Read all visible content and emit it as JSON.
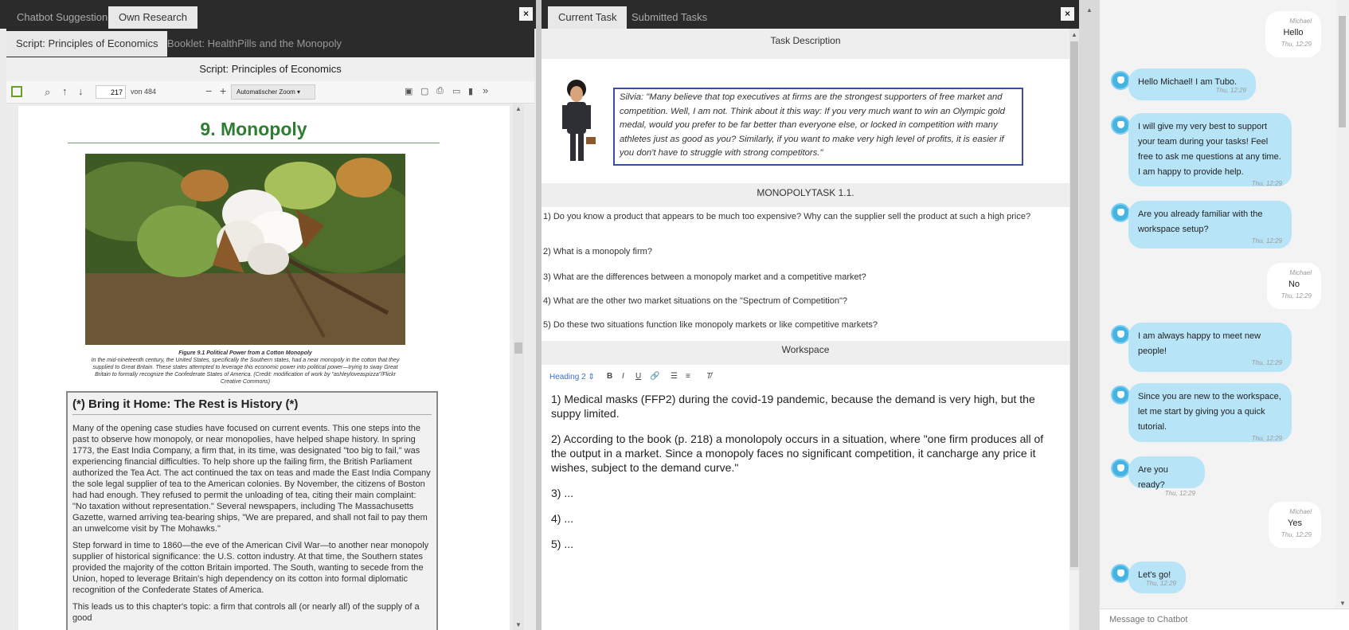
{
  "left": {
    "tabs": [
      {
        "label": "Chatbot Suggestion",
        "active": false
      },
      {
        "label": "Own Research",
        "active": true
      }
    ],
    "subtabs": [
      {
        "label": "Script: Principles of Economics",
        "active": true
      },
      {
        "label": "Booklet: HealthPills and the Monopoly",
        "active": false
      }
    ],
    "doc_title": "Script: Principles of Economics",
    "pdf_toolbar": {
      "page": "217",
      "page_total": "von 484",
      "zoom": "Automatischer Zoom"
    },
    "chapter_title": "9.   Monopoly",
    "figure_caption_title": "Figure 9.1 Political Power from a Cotton Monopoly",
    "figure_caption": "In the mid-nineteenth century, the United States, specifically the Southern states, had a near monopoly in the cotton that they supplied to Great Britain. These states attempted to leverage this economic power into political power—trying to sway Great Britain to formally recognize the Confederate States of America. (Credit: modification of work by \"ashleyloveaspizza\"/Flickr Creative Commons)",
    "box_title": "(*) Bring it Home: The Rest is History (*)",
    "para1": "Many of the opening case studies have focused on current events. This one steps into the past to observe how monopoly, or near monopolies, have helped shape history. In spring 1773, the East India Company, a firm that, in its time, was designated \"too big to fail,\" was experiencing financial difficulties. To help shore up the failing firm, the British Parliament authorized the Tea Act. The act continued the tax on teas and made the East India Company the sole legal supplier of tea to the American colonies. By November, the citizens of Boston had had enough. They refused to permit the unloading of tea, citing their main complaint: \"No taxation without representation.\" Several newspapers, including The Massachusetts Gazette, warned arriving tea-bearing ships, \"We are prepared, and shall not fail to pay them an unwelcome visit by The Mohawks.\"",
    "para2": "Step forward in time to 1860—the eve of the American Civil War—to another near monopoly supplier of historical significance: the U.S. cotton industry. At that time, the Southern states provided the majority of the cotton Britain imported. The South, wanting to secede from the Union, hoped to leverage Britain's high dependency on its cotton into formal diplomatic recognition of the Confederate States of America.",
    "para3": "This leads us to this chapter's topic: a firm that controls all (or nearly all) of the supply of a good"
  },
  "mid": {
    "tabs": [
      {
        "label": "Current Task",
        "active": true
      },
      {
        "label": "Submitted Tasks",
        "active": false
      }
    ],
    "task_description": "Task Description",
    "quote": "Silvia: \"Many believe that top executives at firms are the strongest supporters of free market and competition. Well, I am not. Think about it this way: If you very much want to win an Olympic gold medal, would you prefer to be far better than everyone else, or locked in competition with many athletes just as good as you? Similarly, if you want to make very high level of profits, it is easier if you don't have to struggle with strong competitors.\"",
    "task_title": "MONOPOLYTASK 1.1.",
    "questions": [
      "1) Do you know a product that appears to be much too expensive? Why can the supplier sell the product at such a high price?",
      "2) What is a monopoly firm?",
      "3) What are the differences between a monopoly market and a competitive market?",
      "4) What are the other two market situations on the \"Spectrum of Competition\"?",
      "5) Do these two situations function like monopoly markets or like competitive markets?"
    ],
    "workspace": "Workspace",
    "editor_style": "Heading 2",
    "answers": [
      "1) Medical masks (FFP2) during the covid-19 pandemic, because the demand is very high, but the suppy limited.",
      "2) According to the book (p. 218) a monolopoly occurs in a situation, where \"one firm produces all of the output in a market. Since a monopoly faces no significant competition, it cancharge any price it wishes, subject to the demand curve.\"",
      "3) ...",
      "4) ...",
      "5) ..."
    ]
  },
  "chat": {
    "messages": [
      {
        "from": "user",
        "sender": "Michael",
        "text": "Hello",
        "time": "Thu, 12:29"
      },
      {
        "from": "bot",
        "text": "Hello Michael! I am Tubo.",
        "time": "Thu, 12:29"
      },
      {
        "from": "bot",
        "text": "I will give my very best to support your team during your tasks! Feel free to ask me questions at any time. I am happy to provide help.",
        "time": "Thu, 12:29"
      },
      {
        "from": "bot",
        "text": "Are you already familiar with the workspace setup?",
        "time": "Thu, 12:29"
      },
      {
        "from": "user",
        "sender": "Michael",
        "text": "No",
        "time": "Thu, 12:29"
      },
      {
        "from": "bot",
        "text": "I am always happy to meet new people!",
        "time": "Thu, 12:29"
      },
      {
        "from": "bot",
        "text": "Since you are new to the workspace, let me start by giving you a quick tutorial.",
        "time": "Thu, 12:29"
      },
      {
        "from": "bot",
        "text": "Are you ready?",
        "time": "Thu, 12:29"
      },
      {
        "from": "user",
        "sender": "Michael",
        "text": "Yes",
        "time": "Thu, 12:29"
      },
      {
        "from": "bot",
        "text": "Let's go!",
        "time": "Thu, 12:29"
      }
    ],
    "placeholder": "Message to Chatbot"
  },
  "colors": {
    "bot_bubble": "#b8e4f8",
    "tab_bar": "#2b2b2b",
    "chapter_green": "#2e7d32",
    "quote_border": "#3a4fa3"
  }
}
